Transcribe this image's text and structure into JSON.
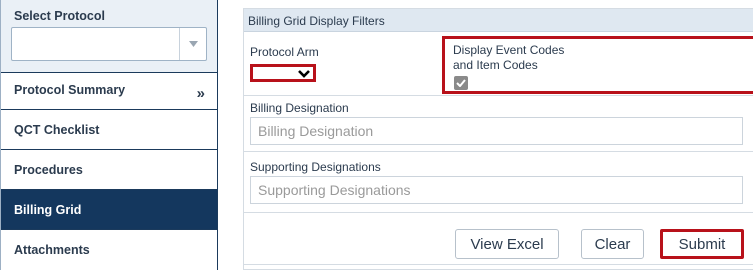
{
  "sidebar": {
    "protocol_label": "Select Protocol",
    "protocol_select_value": "",
    "items": [
      {
        "label": "Protocol Summary",
        "chevron": "»"
      },
      {
        "label": "QCT Checklist"
      },
      {
        "label": "Procedures"
      },
      {
        "label": "Billing Grid",
        "active": true
      },
      {
        "label": "Attachments"
      }
    ]
  },
  "panel": {
    "title": "Billing Grid Display Filters",
    "protocol_arm": {
      "label": "Protocol Arm",
      "value": ""
    },
    "display_codes": {
      "label_line1": "Display Event Codes",
      "label_line2": "and Item Codes",
      "checked": true
    },
    "billing_designation": {
      "label": "Billing Designation",
      "placeholder": "Billing Designation",
      "value": ""
    },
    "supporting_designations": {
      "label": "Supporting Designations",
      "placeholder": "Supporting Designations",
      "value": ""
    },
    "buttons": {
      "view_excel": "View Excel",
      "clear": "Clear",
      "submit": "Submit"
    }
  },
  "colors": {
    "sidebar_active_bg": "#14375e",
    "highlight_border": "#b8111a",
    "panel_header_bg": "#dfe8f1"
  }
}
